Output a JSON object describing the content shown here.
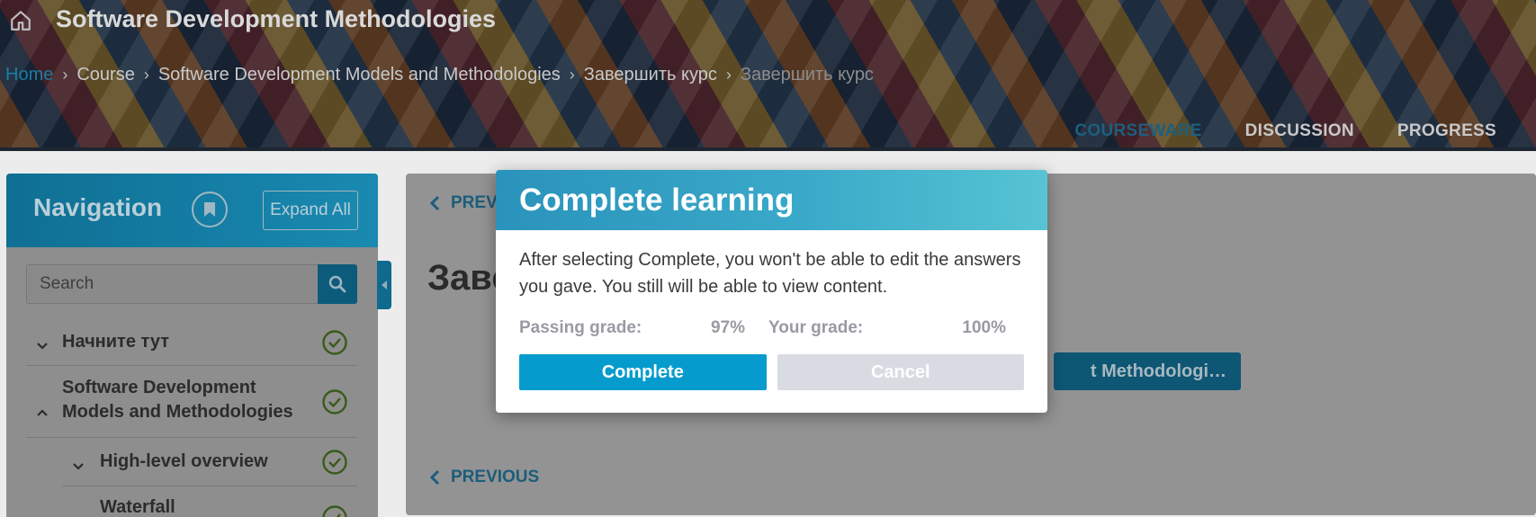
{
  "header": {
    "course_title": "Software Development Methodologies",
    "breadcrumb": [
      {
        "label": "Home"
      },
      {
        "label": "Course"
      },
      {
        "label": "Software Development Models and Methodologies"
      },
      {
        "label": "Завершить курс"
      },
      {
        "label": "Завершить курс"
      }
    ],
    "tabs": [
      {
        "label": "COURSEWARE",
        "active": true
      },
      {
        "label": "DISCUSSION",
        "active": false
      },
      {
        "label": "PROGRESS",
        "active": false
      }
    ]
  },
  "sidebar": {
    "title": "Navigation",
    "expand_label": "Expand All",
    "search_placeholder": "Search",
    "items": [
      {
        "label": "Начните тут",
        "expanded": false,
        "completed": true
      },
      {
        "label": "Software Development Models and Methodologies",
        "expanded": true,
        "completed": true
      },
      {
        "label": "High-level overview",
        "expanded": false,
        "completed": true
      },
      {
        "label": "Waterfall",
        "expanded": false,
        "completed": true
      }
    ]
  },
  "main": {
    "prev_label_top": "PREV",
    "unit_title": "Заве",
    "next_label": "t Methodologi…",
    "prev_label_bottom": "PREVIOUS"
  },
  "modal": {
    "title": "Complete learning",
    "message": "After selecting Complete, you won't be able to edit the answers you gave. You still will be able to view content.",
    "passing_grade_label": "Passing grade:",
    "passing_grade_value": "97%",
    "your_grade_label": "Your grade:",
    "your_grade_value": "100%",
    "complete_label": "Complete",
    "cancel_label": "Cancel"
  },
  "colors": {
    "accent": "#059ccd",
    "nav_header": "#157fa6",
    "check": "#3a5a1a"
  }
}
